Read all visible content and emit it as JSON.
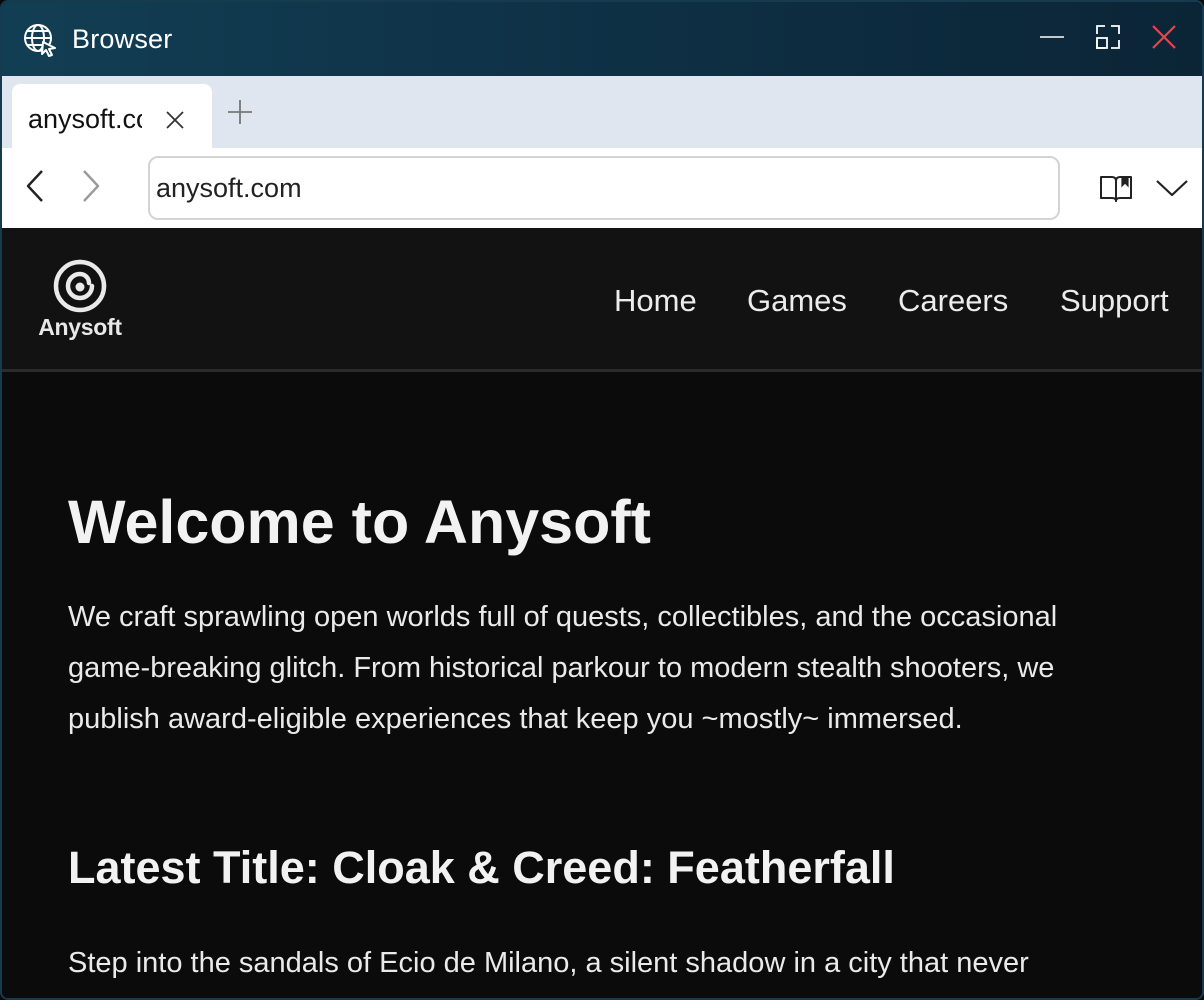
{
  "window": {
    "title": "Browser",
    "icons": {
      "app": "globe-cursor-icon",
      "minimize": "minimize-icon",
      "maximize": "maximize-icon",
      "close": "close-icon"
    },
    "accent_close": "#e0484e",
    "titlebar_color": "#0e2f44"
  },
  "tabs": [
    {
      "label": "anysoft.com",
      "active": true
    }
  ],
  "toolbar": {
    "url": "anysoft.com",
    "icons": {
      "back": "chevron-left-icon",
      "forward": "chevron-right-icon",
      "reader": "book-icon",
      "menu": "chevron-down-icon",
      "new_tab": "plus-icon",
      "tab_close": "x-icon"
    }
  },
  "site": {
    "logo_text": "Anysoft",
    "nav": [
      "Home",
      "Games",
      "Careers",
      "Support"
    ],
    "hero_title": "Welcome to Anysoft",
    "hero_intro": "We craft sprawling open worlds full of quests, collectibles, and the occasional game-breaking glitch. From historical parkour to modern stealth shooters, we publish award-eligible experiences that keep you ~mostly~ immersed.",
    "latest_title": "Latest Title: Cloak & Creed: Featherfall",
    "latest_body": "Step into the sandals of Ecio de Milano, a silent shadow in a city that never"
  }
}
